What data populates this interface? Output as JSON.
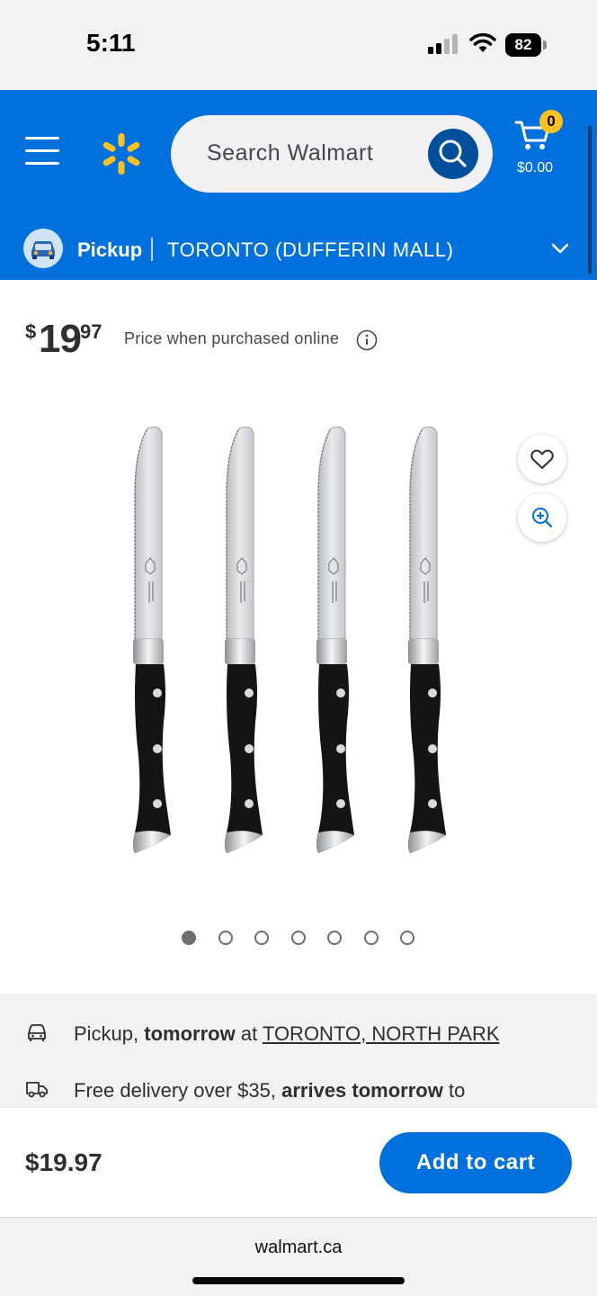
{
  "status_bar": {
    "time": "5:11",
    "battery": "82"
  },
  "header": {
    "search_placeholder": "Search Walmart",
    "cart_count": "0",
    "cart_total": "$0.00",
    "pickup_label": "Pickup",
    "pickup_store": "TORONTO (DUFFERIN MALL)",
    "brand_color": "#0071dc",
    "spark_color": "#ffc220"
  },
  "product": {
    "price_symbol": "$",
    "price_whole": "19",
    "price_cents": "97",
    "price_note": "Price when purchased online",
    "image_count": 7,
    "active_image": 1
  },
  "fulfillment": {
    "pickup": {
      "prefix": "Pickup, ",
      "bold": "tomorrow",
      "middle": " at ",
      "link": "TORONTO, NORTH PARK"
    },
    "delivery": {
      "prefix": "Free delivery over $35, ",
      "bold": "arrives tomorrow",
      "suffix": " to"
    }
  },
  "bottom_bar": {
    "price": "$19.97",
    "add_to_cart": "Add to cart"
  },
  "browser": {
    "url": "walmart.ca"
  }
}
